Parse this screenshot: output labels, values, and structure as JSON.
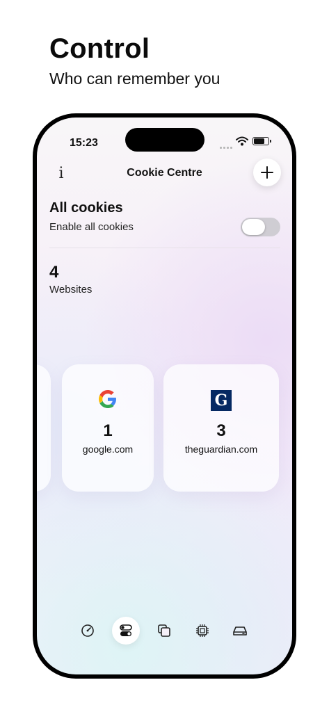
{
  "promo": {
    "headline": "Control",
    "subheadline": "Who can remember you"
  },
  "status_bar": {
    "time": "15:23"
  },
  "nav": {
    "title": "Cookie Centre",
    "info_label": "i"
  },
  "all_cookies": {
    "title": "All cookies",
    "subtitle": "Enable all cookies",
    "toggle_on": false
  },
  "websites": {
    "count": "4",
    "label": "Websites"
  },
  "sites": [
    {
      "domain": "google.com",
      "count": "1",
      "icon": "google-logo"
    },
    {
      "domain": "theguardian.com",
      "count": "3",
      "icon": "guardian-logo",
      "logo_letter": "G"
    }
  ],
  "tabs": [
    {
      "icon": "speedometer-icon"
    },
    {
      "icon": "toggles-icon",
      "active": true
    },
    {
      "icon": "copy-icon"
    },
    {
      "icon": "chip-icon"
    },
    {
      "icon": "drive-icon"
    }
  ],
  "colors": {
    "guardian_blue": "#052962",
    "google_blue": "#4285F4",
    "google_red": "#EA4335",
    "google_yellow": "#FBBC05",
    "google_green": "#34A853"
  }
}
